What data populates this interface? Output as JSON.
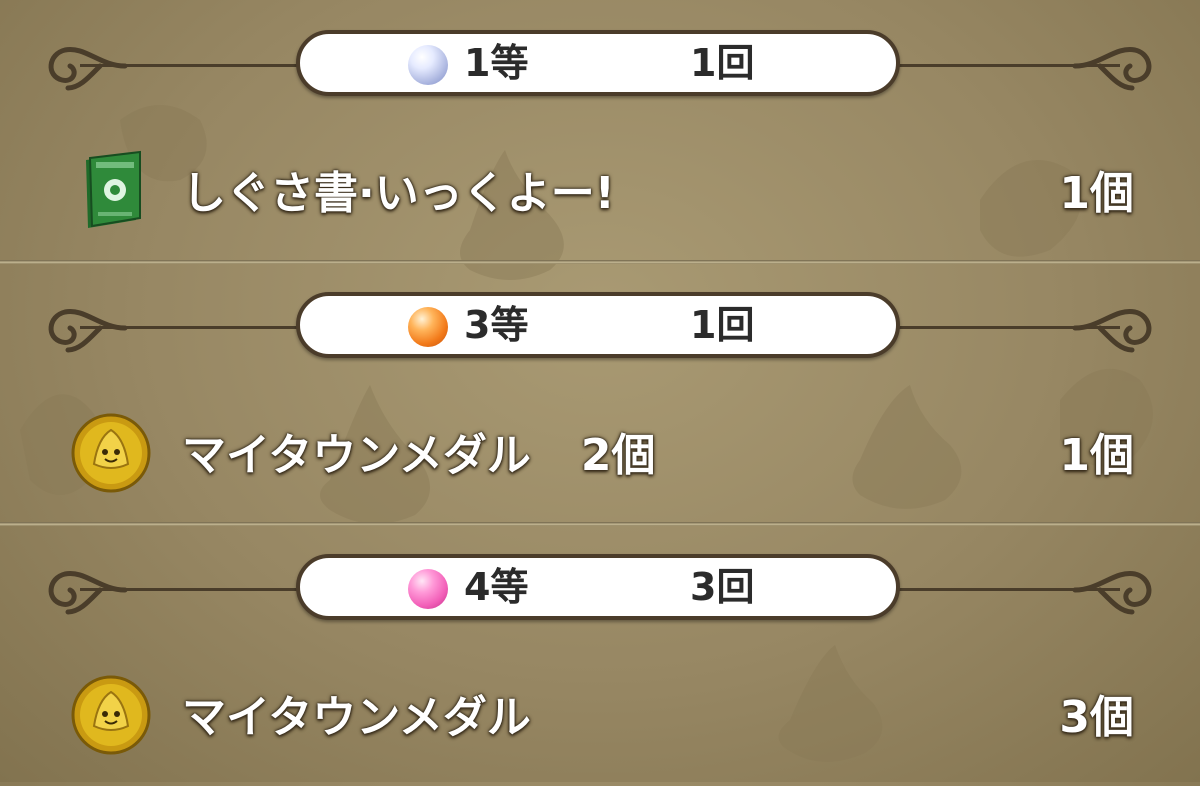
{
  "colors": {
    "background": "#978763",
    "pill_border": "#4b3c2a",
    "gem_silver": "#d9dff5",
    "gem_orange": "#f27a1a",
    "gem_pink": "#f25fb8",
    "book_green": "#2f8a3a",
    "medal_gold": "#e0b81e"
  },
  "prizes": [
    {
      "gem_icon": "silver-orb-icon",
      "rank": "1等",
      "draws": "1回",
      "item_icon": "green-book-icon",
      "item_name": "しぐさ書·いっくよー!",
      "item_sub_qty": "",
      "item_qty": "1個"
    },
    {
      "gem_icon": "orange-orb-icon",
      "rank": "3等",
      "draws": "1回",
      "item_icon": "gold-medal-icon",
      "item_name": "マイタウンメダル",
      "item_sub_qty": "2個",
      "item_qty": "1個"
    },
    {
      "gem_icon": "pink-orb-icon",
      "rank": "4等",
      "draws": "3回",
      "item_icon": "gold-medal-icon",
      "item_name": "マイタウンメダル",
      "item_sub_qty": "",
      "item_qty": "3個"
    }
  ]
}
